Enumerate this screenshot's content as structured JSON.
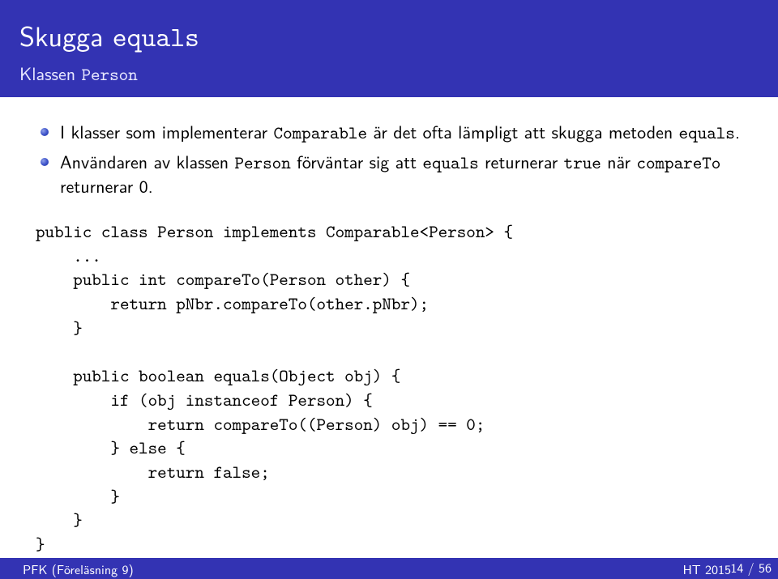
{
  "header": {
    "title_pre": "Skugga ",
    "title_tt": "equals",
    "subtitle_pre": "Klassen ",
    "subtitle_tt": "Person"
  },
  "bullets": {
    "b1_a": "I klasser som implementerar ",
    "b1_tt1": "Comparable",
    "b1_b": " är det ofta lämpligt att skugga metoden ",
    "b1_tt2": "equals",
    "b1_c": ".",
    "b2_a": "Användaren av klassen ",
    "b2_tt1": "Person",
    "b2_b": " förväntar sig att ",
    "b2_tt2": "equals",
    "b2_c": " returnerar ",
    "b2_tt3": "true",
    "b2_d": " när ",
    "b2_tt4": "compareTo",
    "b2_e": " returnerar 0."
  },
  "code": "public class Person implements Comparable<Person> {\n    ...\n    public int compareTo(Person other) {\n        return pNbr.compareTo(other.pNbr);\n    }\n\n    public boolean equals(Object obj) {\n        if (obj instanceof Person) {\n            return compareTo((Person) obj) == 0;\n        } else {\n            return false;\n        }\n    }\n}",
  "footer": {
    "left": "PFK (Föreläsning 9)",
    "center": "",
    "right": "HT 2015",
    "page": "14 / 56"
  }
}
